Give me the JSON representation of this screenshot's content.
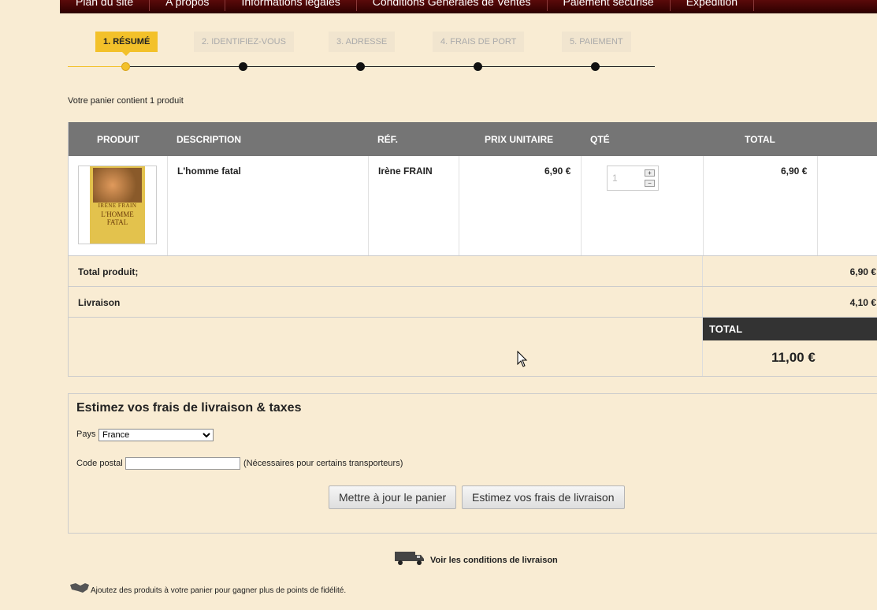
{
  "nav": [
    "Plan du site",
    "A propos",
    "Informations légales",
    "Conditions Générales de Ventes",
    "Paiement sécurisé",
    "Expédition"
  ],
  "steps": [
    "1. RÉSUMÉ",
    "2. IDENTIFIEZ-VOUS",
    "3. ADRESSE",
    "4. FRAIS DE PORT",
    "5. PAIEMENT"
  ],
  "summary": "Votre panier contient 1 produit",
  "table": {
    "headers": [
      "PRODUIT",
      "DESCRIPTION",
      "RÉF.",
      "PRIX UNITAIRE",
      "QTÉ",
      "TOTAL"
    ],
    "product": {
      "cover_author": "IRÈNE FRAIN",
      "cover_title": "L'HOMME FATAL",
      "description": "L'homme fatal",
      "ref": "Irène FRAIN",
      "unit_price": "6,90 €",
      "qty": "1",
      "total": "6,90 €"
    },
    "total_products_label": "Total produit;",
    "total_products_value": "6,90 €",
    "shipping_label": "Livraison",
    "shipping_value": "4,10 €",
    "grand_total_label": "TOTAL",
    "grand_total_value": "11,00 €"
  },
  "estimate": {
    "title": "Estimez vos frais de livraison & taxes",
    "country_label": "Pays",
    "country_value": "France",
    "postal_label": "Code postal",
    "postal_value": "",
    "postal_note": "(Nécessaires pour certains transporteurs)",
    "update_button": "Mettre à jour le panier",
    "estimate_button": "Estimez vos frais de livraison"
  },
  "delivery_link": "Voir les conditions de livraison",
  "loyalty_text": "Ajoutez des produits à votre panier pour gagner plus de points de fidélité."
}
